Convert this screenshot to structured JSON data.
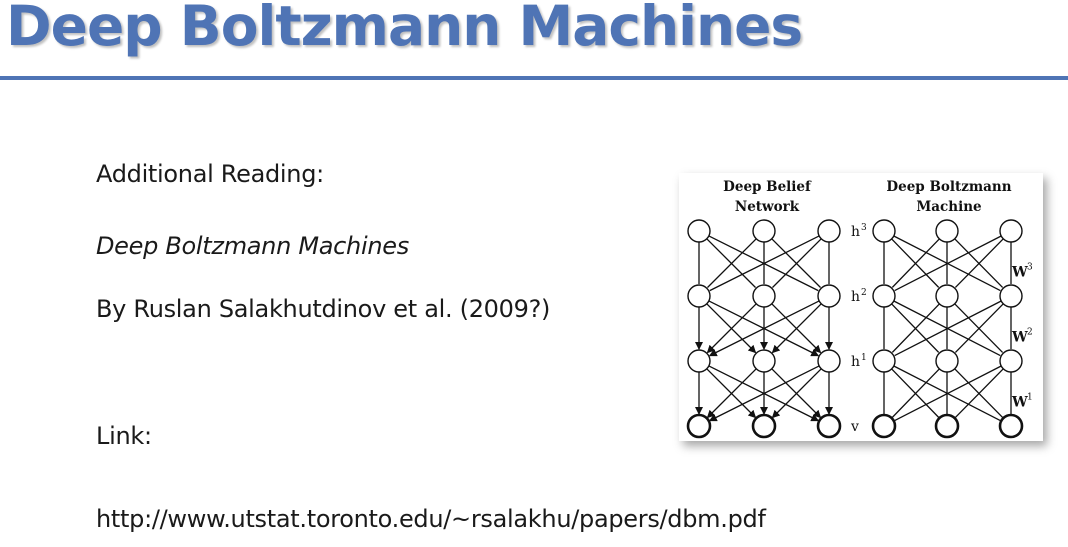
{
  "slide": {
    "title": "Deep Boltzmann Machines",
    "additional_reading_label": "Additional Reading:",
    "paper_title": "Deep Boltzmann Machines",
    "byline": "By Ruslan Salakhutdinov et al. (2009?)",
    "link_label": "Link:",
    "link_url": "http://www.utstat.toronto.edu/~rsalakhu/papers/dbm.pdf"
  },
  "figure": {
    "left_title_1": "Deep Belief",
    "left_title_2": "Network",
    "right_title_1": "Deep Boltzmann",
    "right_title_2": "Machine",
    "layer_labels": [
      {
        "base": "h",
        "sup": "3"
      },
      {
        "base": "h",
        "sup": "2"
      },
      {
        "base": "h",
        "sup": "1"
      },
      {
        "base": "v",
        "sup": ""
      }
    ],
    "weight_labels": [
      {
        "base": "W",
        "sup": "3"
      },
      {
        "base": "W",
        "sup": "2"
      },
      {
        "base": "W",
        "sup": "1"
      }
    ]
  },
  "colors": {
    "title": "#4f74b5",
    "rule": "#4f74b5",
    "text": "#1a1a1a"
  }
}
